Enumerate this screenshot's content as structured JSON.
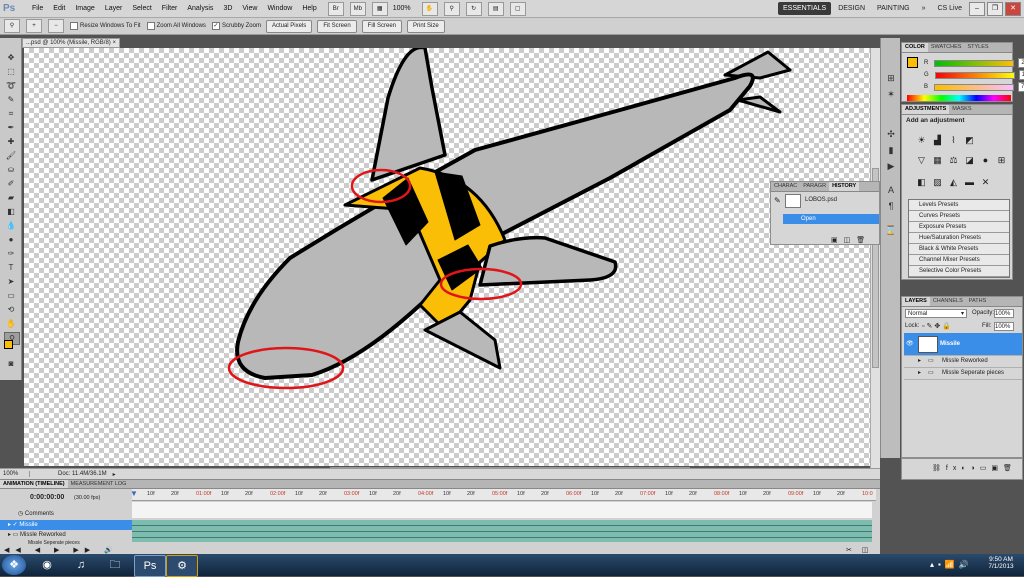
{
  "menu": {
    "logo": "Ps",
    "items": [
      "File",
      "Edit",
      "Image",
      "Layer",
      "Select",
      "Filter",
      "Analysis",
      "3D",
      "View",
      "Window",
      "Help"
    ],
    "zoom": "100%",
    "workspaces": [
      "ESSENTIALS",
      "DESIGN",
      "PAINTING"
    ],
    "more": "»",
    "cs_live": "CS Live"
  },
  "options": {
    "resize_windows": "Resize Windows To Fit",
    "zoom_all": "Zoom All Windows",
    "scrubby_zoom": "Scrubby Zoom",
    "actual_pixels": "Actual Pixels",
    "fit_screen": "Fit Screen",
    "fill_screen": "Fill Screen",
    "print_size": "Print Size"
  },
  "document": {
    "tab": "...psd @ 100% (Missile, RGB/8)",
    "zoom": "100%",
    "doc_size": "Doc: 11.4M/36.1M"
  },
  "color_panel": {
    "tabs": [
      "COLOR",
      "SWATCHES",
      "STYLES"
    ],
    "r_label": "R",
    "g_label": "G",
    "b_label": "B",
    "r": 250,
    "g": 190,
    "b": 7,
    "fg_color": "#fabe07"
  },
  "adjustments": {
    "tabs": [
      "ADJUSTMENTS",
      "MASKS"
    ],
    "title": "Add an adjustment",
    "presets": [
      "Levels Presets",
      "Curves Presets",
      "Exposure Presets",
      "Hue/Saturation Presets",
      "Black & White Presets",
      "Channel Mixer Presets",
      "Selective Color Presets"
    ]
  },
  "history": {
    "tabs": [
      "CHARAC",
      "PARAGR",
      "HISTORY"
    ],
    "snapshot": "LOBOS.psd",
    "state": "Open"
  },
  "layers": {
    "tabs": [
      "LAYERS",
      "CHANNELS",
      "PATHS"
    ],
    "blend_mode": "Normal",
    "opacity_label": "Opacity:",
    "opacity": "100%",
    "lock_label": "Lock:",
    "fill_label": "Fill:",
    "fill": "100%",
    "items": [
      "Missile",
      "Missle Reworked",
      "Missle Seperate pieces"
    ]
  },
  "timeline": {
    "tabs": [
      "ANIMATION (TIMELINE)",
      "MEASUREMENT LOG"
    ],
    "time": "0:00:00:00",
    "fps": "(30.00 fps)",
    "ruler": [
      "10f",
      "20f",
      "01:00f",
      "10f",
      "20f",
      "02:00f",
      "10f",
      "20f",
      "03:00f",
      "10f",
      "20f",
      "04:00f",
      "10f",
      "20f",
      "05:00f",
      "10f",
      "20f",
      "06:00f",
      "10f",
      "20f",
      "07:00f",
      "10f",
      "20f",
      "08:00f",
      "10f",
      "20f",
      "09:00f",
      "10f",
      "20f",
      "10:0"
    ],
    "comments": "Comments",
    "tracks": [
      "Missile",
      "Missle Reworked",
      "Missle Seperate pieces"
    ]
  },
  "taskbar": {
    "time": "9:50 AM",
    "date": "7/1/2013"
  }
}
